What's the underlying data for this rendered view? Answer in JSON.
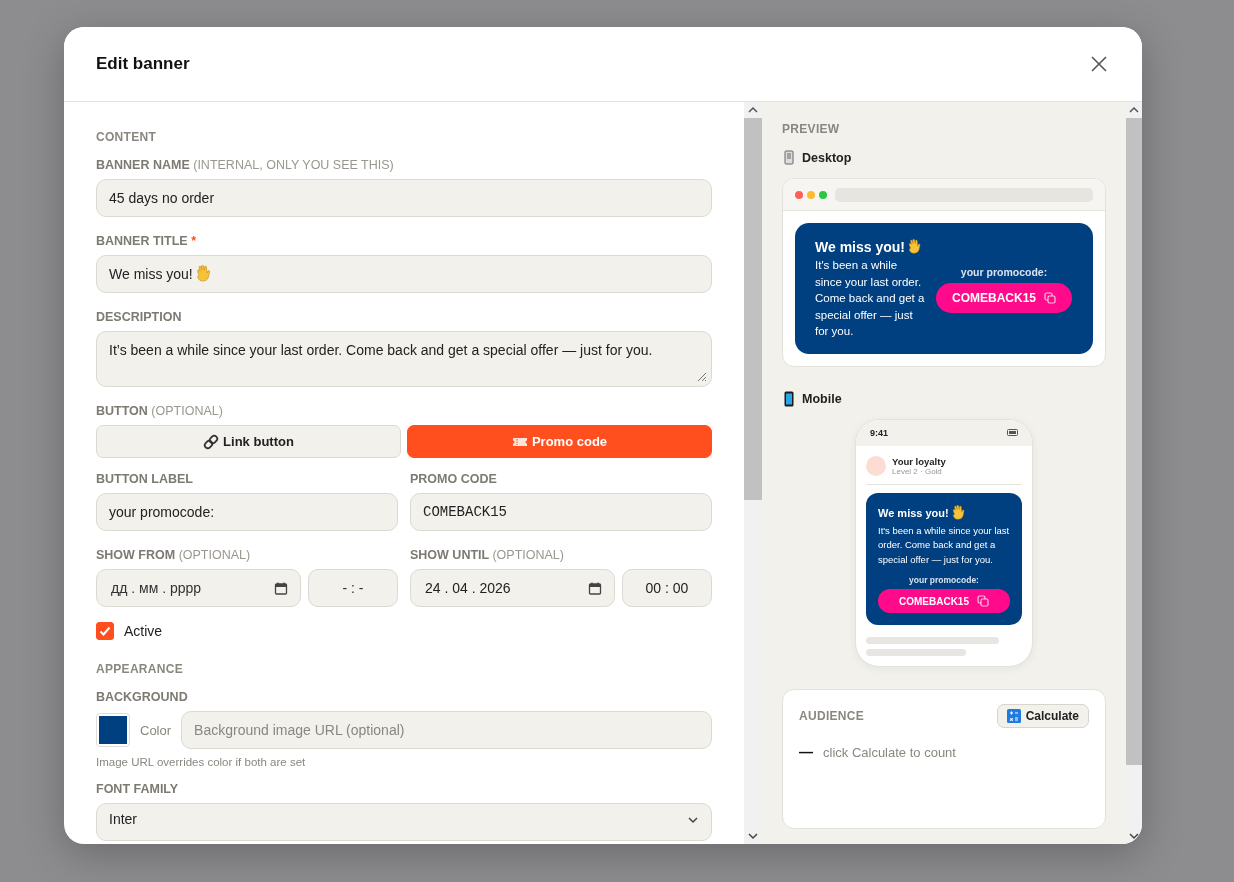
{
  "modal": {
    "title": "Edit banner"
  },
  "form": {
    "content_heading": "CONTENT",
    "banner_name": {
      "label": "BANNER NAME",
      "hint": "(INTERNAL, ONLY YOU SEE THIS)",
      "value": "45 days no order"
    },
    "banner_title": {
      "label": "BANNER TITLE",
      "required_mark": "*",
      "value": "We miss you!"
    },
    "description": {
      "label": "DESCRIPTION",
      "value": "It’s been a while since your last order. Come back and get a special offer — just for you."
    },
    "button_type": {
      "label": "BUTTON",
      "hint": "(OPTIONAL)",
      "options": [
        {
          "kind": "link",
          "label": "Link button",
          "selected": false
        },
        {
          "kind": "promo",
          "label": "Promo code",
          "selected": true
        }
      ]
    },
    "button_label": {
      "label": "BUTTON LABEL",
      "value": "your promocode:"
    },
    "promo_code": {
      "label": "PROMO CODE",
      "value": "COMEBACK15"
    },
    "show_from": {
      "label": "SHOW FROM",
      "hint": "(OPTIONAL)",
      "date_placeholder": "дд . мм . рррр",
      "time_placeholder": "- : -"
    },
    "show_until": {
      "label": "SHOW UNTIL",
      "hint": "(OPTIONAL)",
      "date": "24 . 04 . 2026",
      "time": "00 : 00"
    },
    "active": {
      "label": "Active",
      "checked": true
    },
    "appearance_heading": "APPEARANCE",
    "background": {
      "label": "BACKGROUND",
      "color": "#003f80",
      "color_label": "Color",
      "url_placeholder": "Background image URL (optional)",
      "help": "Image URL overrides color if both are set"
    },
    "font_family": {
      "label": "FONT FAMILY",
      "value": "Inter"
    }
  },
  "preview": {
    "heading": "PREVIEW",
    "desktop": {
      "label": "Desktop",
      "title": "We miss you!",
      "description": "It's been a while since your last order. Come back and get a special offer — just for you.",
      "button_label": "your promocode:",
      "code": "COMEBACK15"
    },
    "mobile": {
      "label": "Mobile",
      "time": "9:41",
      "loyalty_title": "Your loyalty",
      "loyalty_level": "Level 2 · Gold",
      "title": "We miss you!",
      "description": "It's been a while since your last order. Come back and get a special offer — just for you.",
      "button_label": "your promocode:",
      "code": "COMEBACK15"
    },
    "audience": {
      "heading": "AUDIENCE",
      "button": "Calculate",
      "value": "—",
      "hint": "click Calculate to count"
    }
  }
}
